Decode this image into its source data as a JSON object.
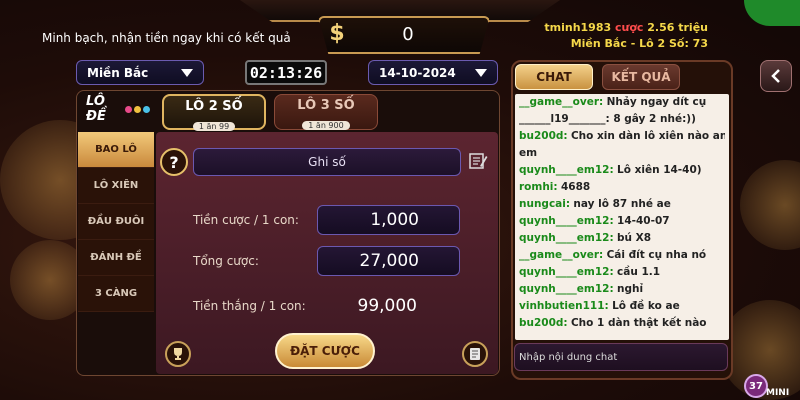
{
  "header": {
    "tagline": "Minh bạch, nhận tiền ngay khi có kết quả",
    "currency_symbol": "$",
    "balance": "0",
    "user_name": "tminh1983",
    "bet_label": "cược",
    "bet_amount": "2.56 triệu",
    "user_region_game": "Miền Bắc - Lô 2 Số: 73"
  },
  "selectors": {
    "region": "Miền Bắc",
    "timer": "02:13:26",
    "date": "14-10-2024"
  },
  "game": {
    "logo": "LÔ ĐỀ",
    "tabs": [
      {
        "label": "LÔ 2 SỐ",
        "odds": "1 ăn 99"
      },
      {
        "label": "LÔ 3 SỐ",
        "odds": "1 ăn 900"
      }
    ],
    "side_menu": [
      "BAO LÔ",
      "LÔ XIÊN",
      "ĐẦU ĐUÔI",
      "ĐÁNH ĐỀ",
      "3 CÀNG"
    ],
    "help_label": "?",
    "ghiso_label": "Ghi số",
    "bet_per_label": "Tiền cược / 1 con:",
    "bet_per_value": "1,000",
    "total_label": "Tổng cược:",
    "total_value": "27,000",
    "win_label": "Tiền thắng / 1 con:",
    "win_value": "99,000",
    "place_bet_label": "ĐẶT CƯỢC"
  },
  "chat": {
    "tab_chat": "CHAT",
    "tab_result": "KẾT QUẢ",
    "messages": [
      {
        "user": "__game__over:",
        "text": "Nhảy ngay dít cụ"
      },
      {
        "user": "",
        "text": "______l19_______: 8 gây 2 nhé:))"
      },
      {
        "user": "bu200d:",
        "text": "Cho xin dàn lô xiên nào anh"
      },
      {
        "user": "",
        "text": "em"
      },
      {
        "user": "quynh____em12:",
        "text": "Lô xiên 14-40)"
      },
      {
        "user": "romhi:",
        "text": "4688"
      },
      {
        "user": "nungcai:",
        "text": "nay lô 87 nhé ae"
      },
      {
        "user": "quynh____em12:",
        "text": "14-40-07"
      },
      {
        "user": "quynh____em12:",
        "text": "bú X8"
      },
      {
        "user": "__game__over:",
        "text": "Cái đít cụ nha nó"
      },
      {
        "user": "quynh____em12:",
        "text": "cầu 1.1"
      },
      {
        "user": "quynh____em12:",
        "text": "nghỉ"
      },
      {
        "user": "vinhbutien111:",
        "text": "Lô đề ko ae"
      },
      {
        "user": "bu200d:",
        "text": "Cho 1 dàn thật kết nào"
      }
    ],
    "input_placeholder": "Nhập nội dung chat"
  },
  "mini": {
    "count": "37",
    "label": "MINI"
  },
  "colors": {
    "gold": "#e0b560",
    "username_green": "#1a8a1a",
    "highlight_yellow": "#f5d84a"
  }
}
